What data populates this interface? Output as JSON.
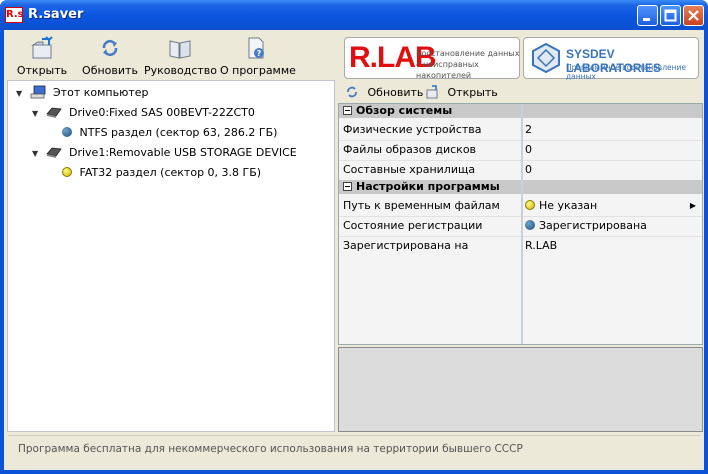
{
  "window": {
    "title": "R.saver",
    "icon_text": "R.s"
  },
  "toolbar": {
    "open_label": "Открыть",
    "refresh_label": "Обновить",
    "manual_label": "Руководство",
    "about_label": "О программе"
  },
  "logos": {
    "rlab_name": "R.LAB",
    "rlab_tagline": "Восстановление данных с неисправных накопителей",
    "sysdev_name": "SYSDEV LABORATORIES",
    "sysdev_tagline": "Программное восстановление данных"
  },
  "tree": {
    "root_label": "Этот компьютер",
    "drive0_label": "Drive0:Fixed SAS 00BEVT-22ZCT0",
    "drive0_partition": "NTFS раздел (сектор 63, 286.2 ГБ)",
    "drive1_label": "Drive1:Removable USB STORAGE DEVICE",
    "drive1_partition": "FAT32 раздел (сектор 0, 3.8 ГБ)"
  },
  "right_toolbar": {
    "refresh_label": "Обновить",
    "open_label": "Открыть"
  },
  "properties": {
    "cat_overview": "Обзор системы",
    "physical_devices_label": "Физические устройства",
    "physical_devices_value": "2",
    "disk_images_label": "Файлы образов дисков",
    "disk_images_value": "0",
    "composite_storage_label": "Составные хранилища",
    "composite_storage_value": "0",
    "cat_settings": "Настройки программы",
    "temp_path_label": "Путь к временным файлам",
    "temp_path_value": "Не указан",
    "registration_state_label": "Состояние регистрации",
    "registration_state_value": "Зарегистрирована",
    "registered_to_label": "Зарегистрирована на",
    "registered_to_value": "R.LAB"
  },
  "status": {
    "text": "Программа бесплатна для некоммерческого использования на территории бывшего СССР"
  },
  "colors": {
    "titlebar": "#0a56de",
    "client_bg": "#ece9d8",
    "category_row": "#c9c9c9",
    "rlab_red": "#e01010",
    "sysdev_blue": "#3a73b8"
  }
}
